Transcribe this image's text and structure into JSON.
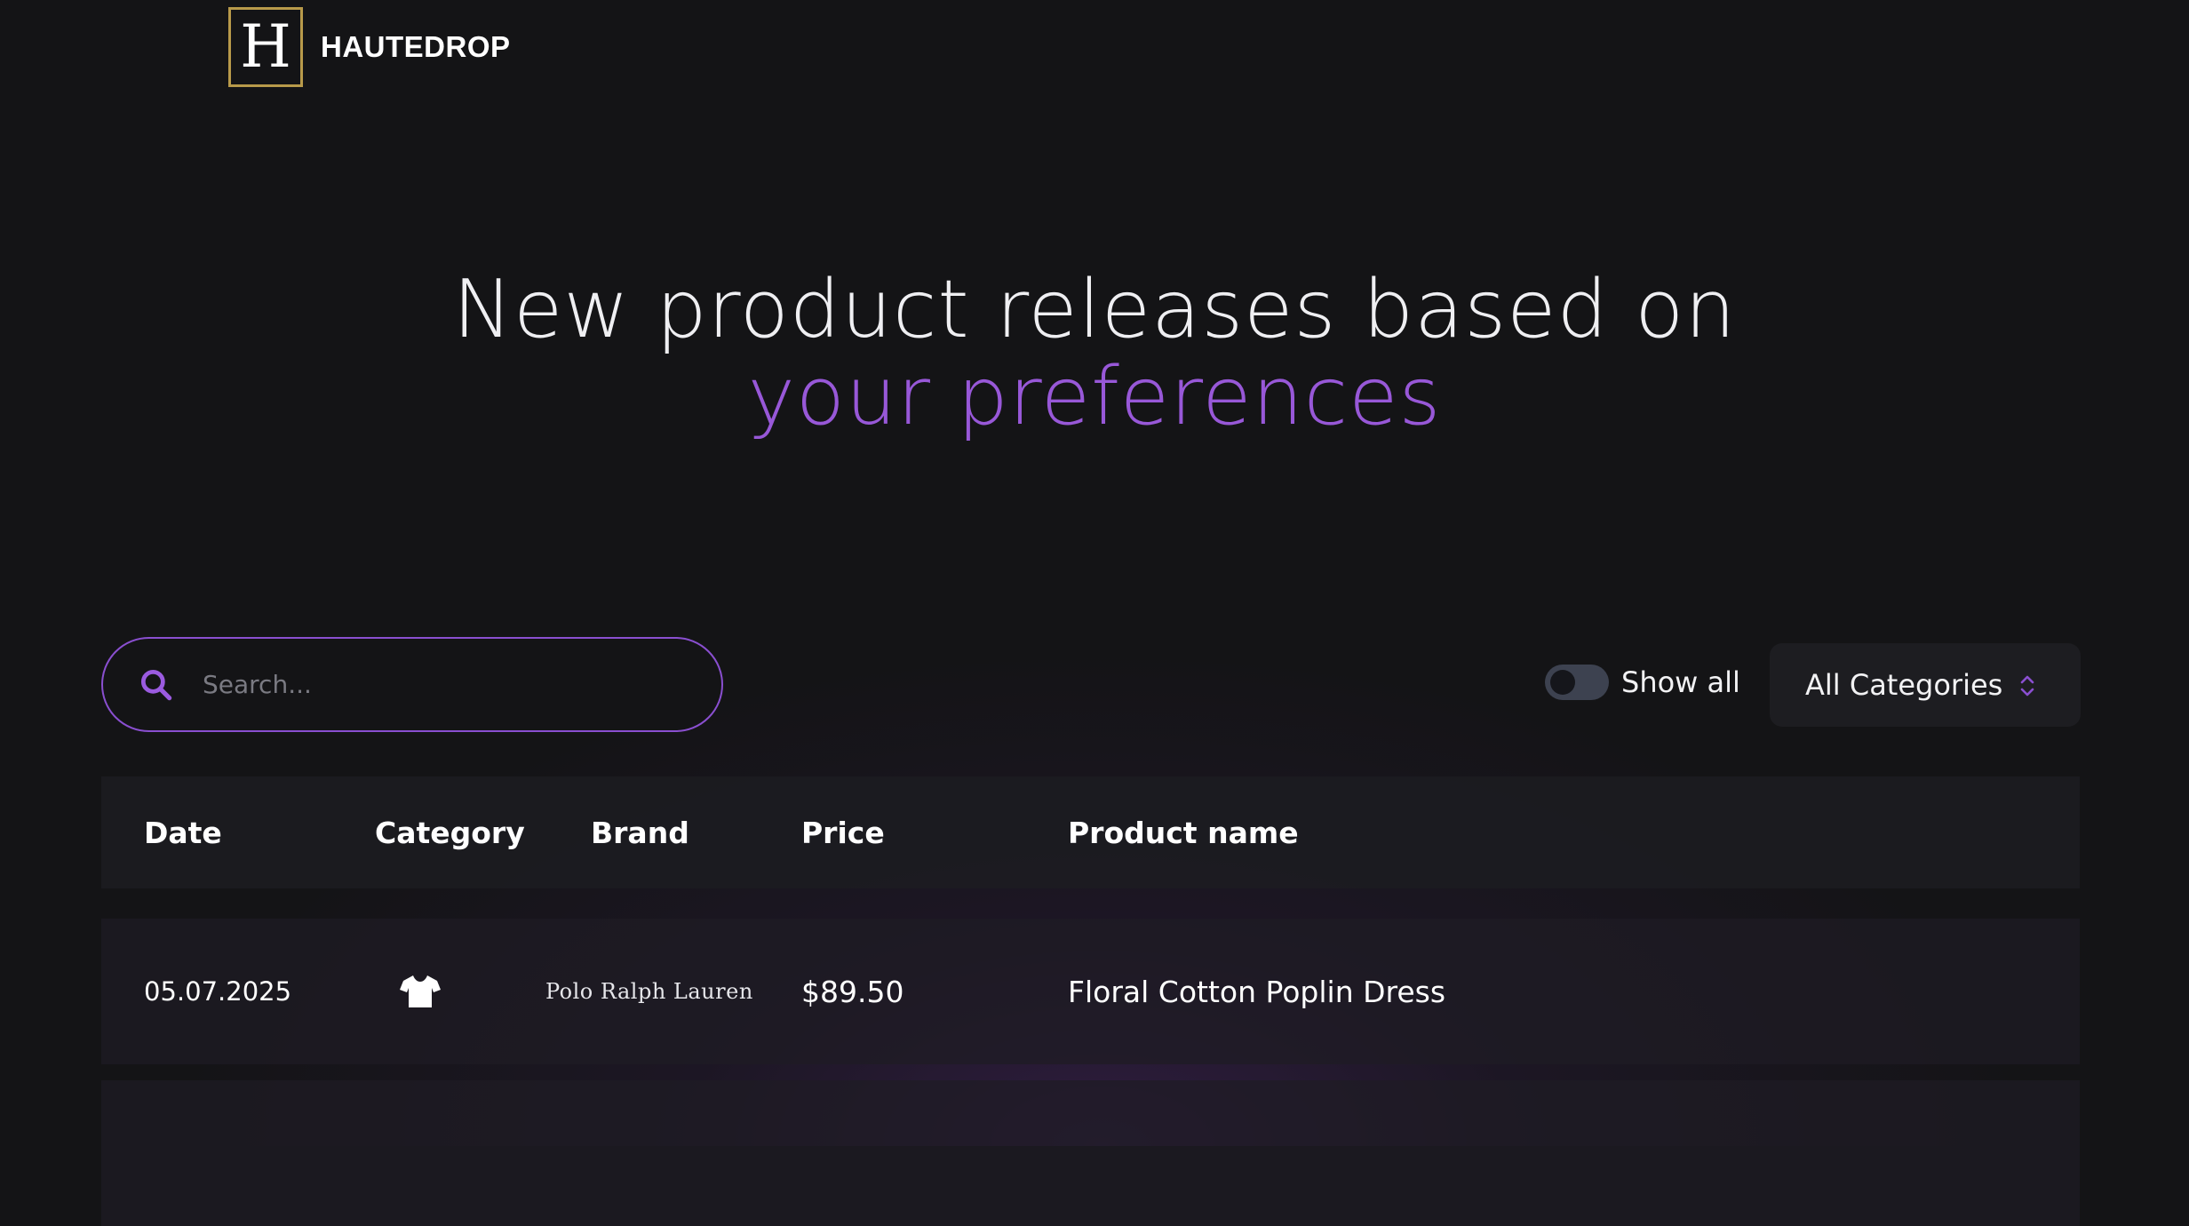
{
  "brand": {
    "logo_letter": "H",
    "name": "HAUTEDROP",
    "accent": "#b89a4a"
  },
  "hero": {
    "line1": "New product releases based on",
    "line2": "your preferences",
    "highlight_color": "#9858d8"
  },
  "filters": {
    "search_placeholder": "Search...",
    "search_icon": "search-icon",
    "toggle_label": "Show all",
    "toggle_on": false,
    "category_select": "All Categories",
    "category_select_icon": "chevron-up-down-icon"
  },
  "table": {
    "columns": [
      "Date",
      "Category",
      "Brand",
      "Price",
      "Product name"
    ],
    "rows": [
      {
        "date": "05.07.2025",
        "category_icon": "tshirt-icon",
        "brand": "Polo Ralph Lauren",
        "price": "$89.50",
        "product_name": "Floral Cotton Poplin Dress"
      }
    ]
  }
}
